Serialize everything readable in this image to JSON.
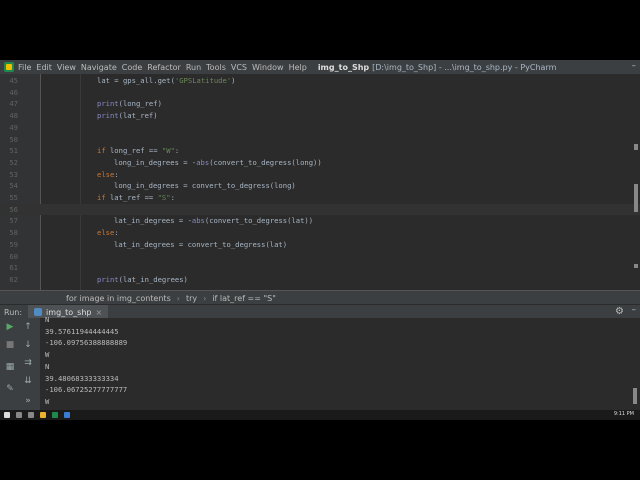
{
  "menu": {
    "items": [
      "File",
      "Edit",
      "View",
      "Navigate",
      "Code",
      "Refactor",
      "Run",
      "Tools",
      "VCS",
      "Window",
      "Help"
    ],
    "window_title_bold": "img_to_Shp",
    "window_title_rest": "[D:\\img_to_Shp] - ...\\img_to_shp.py - PyCharm"
  },
  "editor": {
    "lines": [
      {
        "n": "45",
        "text": "lat = gps_all.get('GPSLatitude')",
        "indent": 1
      },
      {
        "n": "46",
        "text": "",
        "indent": 1
      },
      {
        "n": "47",
        "text": "print(long_ref)",
        "indent": 1
      },
      {
        "n": "48",
        "text": "print(lat_ref)",
        "indent": 1
      },
      {
        "n": "49",
        "text": "",
        "indent": 1
      },
      {
        "n": "50",
        "text": "",
        "indent": 1
      },
      {
        "n": "51",
        "text": "if long_ref == \"W\":",
        "indent": 1
      },
      {
        "n": "52",
        "text": "long_in_degrees = -abs(convert_to_degress(long))",
        "indent": 2
      },
      {
        "n": "53",
        "text": "else:",
        "indent": 1
      },
      {
        "n": "54",
        "text": "long_in_degrees = convert_to_degress(long)",
        "indent": 2
      },
      {
        "n": "55",
        "text": "if lat_ref == \"S\":",
        "indent": 1
      },
      {
        "n": "56",
        "text": "",
        "indent": 1
      },
      {
        "n": "57",
        "text": "lat_in_degrees = -abs(convert_to_degress(lat))",
        "indent": 2
      },
      {
        "n": "58",
        "text": "else:",
        "indent": 1
      },
      {
        "n": "59",
        "text": "lat_in_degrees = convert_to_degress(lat)",
        "indent": 2
      },
      {
        "n": "60",
        "text": "",
        "indent": 1
      },
      {
        "n": "61",
        "text": "",
        "indent": 1
      },
      {
        "n": "62",
        "text": "print(lat_in_degrees)",
        "indent": 1
      }
    ]
  },
  "breadcrumb": [
    "for image in img_contents",
    "try",
    "if lat_ref == \"S\""
  ],
  "run": {
    "label": "Run:",
    "tab": "img_to_shp",
    "output": [
      "N",
      "39.57611944444445",
      "-106.09756388888889",
      "W",
      "N",
      "39.48068333333334",
      "-106.06725277777777",
      "W"
    ]
  },
  "taskbar": {
    "clock": "9:11 PM"
  }
}
